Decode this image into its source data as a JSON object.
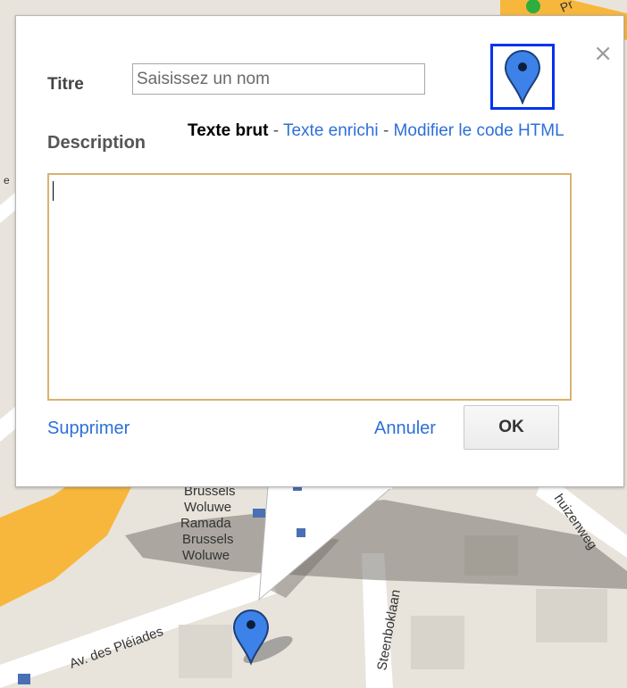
{
  "dialog": {
    "title_label": "Titre",
    "title_placeholder": "Saisissez un nom",
    "title_value": "",
    "description_label": "Description",
    "modes": {
      "plain": "Texte brut",
      "separator": "-",
      "rich": "Texte enrichi",
      "html": "Modifier le code HTML"
    },
    "description_value": "",
    "delete_label": "Supprimer",
    "cancel_label": "Annuler",
    "ok_label": "OK",
    "close_symbol": "×",
    "marker_icon": "blue-pin-icon"
  },
  "map": {
    "labels": {
      "hotel_brussels_top": "Brussels",
      "hotel_woluwe_top": "Woluwe",
      "hotel_ramada": "Ramada",
      "hotel_brussels": "Brussels",
      "hotel_woluwe": "Woluwe",
      "street_pleiades": "Av. des Pléiades",
      "street_steenboklaan": "Steenboklaan",
      "street_huizenweg": "huizenweg",
      "edge_top": "Pr",
      "edge_left": "e"
    }
  },
  "colors": {
    "link": "#2d6fd9",
    "highway": "#f7b73c",
    "marker": "#3d82e8",
    "selected_border": "#0033ee",
    "textarea_border": "#d9b26e"
  }
}
